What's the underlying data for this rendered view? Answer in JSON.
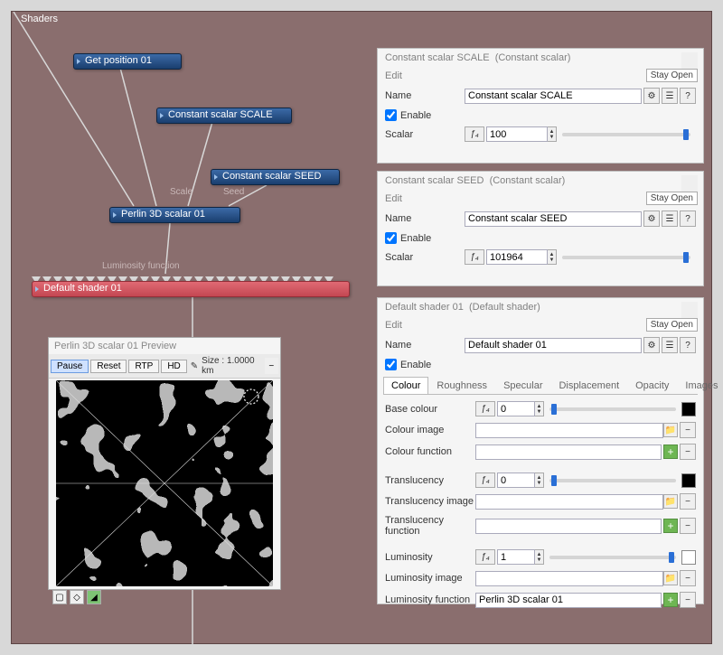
{
  "workspace": {
    "title": "Shaders"
  },
  "nodes": {
    "getpos": "Get position 01",
    "scale": "Constant scalar SCALE",
    "seed": "Constant scalar SEED",
    "perlin": "Perlin 3D scalar 01",
    "shader": "Default shader 01",
    "port_scale": "Scale",
    "port_seed": "Seed",
    "port_lum": "Luminosity function"
  },
  "panel_scale": {
    "title": "Constant scalar SCALE",
    "subtitle": "(Constant scalar)",
    "edit": "Edit",
    "stay_open": "Stay Open",
    "name_label": "Name",
    "name_value": "Constant scalar SCALE",
    "enable": "Enable",
    "scalar_label": "Scalar",
    "scalar_value": "100"
  },
  "panel_seed": {
    "title": "Constant scalar SEED",
    "subtitle": "(Constant scalar)",
    "edit": "Edit",
    "stay_open": "Stay Open",
    "name_label": "Name",
    "name_value": "Constant scalar SEED",
    "enable": "Enable",
    "scalar_label": "Scalar",
    "scalar_value": "101964"
  },
  "panel_shader": {
    "title": "Default shader 01",
    "subtitle": "(Default shader)",
    "edit": "Edit",
    "stay_open": "Stay Open",
    "name_label": "Name",
    "name_value": "Default shader 01",
    "enable": "Enable",
    "tabs": [
      "Colour",
      "Roughness",
      "Specular",
      "Displacement",
      "Opacity",
      "Images"
    ],
    "base_colour": "Base colour",
    "base_colour_value": "0",
    "colour_image": "Colour image",
    "colour_function": "Colour function",
    "translucency": "Translucency",
    "translucency_value": "0",
    "translucency_image": "Translucency image",
    "translucency_function": "Translucency function",
    "luminosity": "Luminosity",
    "luminosity_value": "1",
    "luminosity_image": "Luminosity image",
    "luminosity_function": "Luminosity function",
    "luminosity_function_value": "Perlin 3D scalar 01"
  },
  "preview": {
    "title": "Perlin 3D scalar 01 Preview",
    "pause": "Pause",
    "reset": "Reset",
    "rtp": "RTP",
    "hd": "HD",
    "size_label": "Size : 1.0000 km"
  },
  "icons": {
    "gear": "⚙",
    "txt": "☰",
    "help": "?",
    "brush": "✎",
    "folder": "📁",
    "plus": "+",
    "minus": "−",
    "fx": "ƒ₄"
  }
}
